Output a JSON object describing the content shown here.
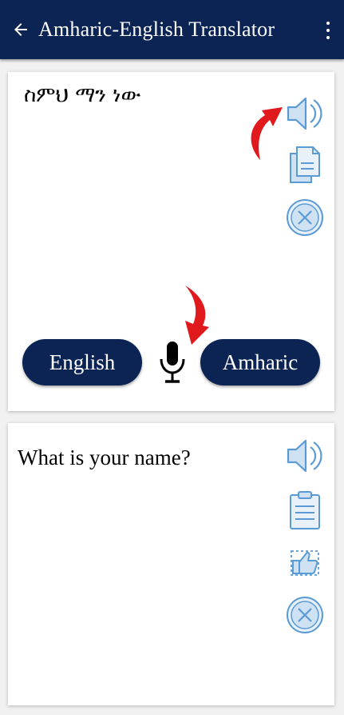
{
  "appbar": {
    "title": "Amharic-English Translator",
    "back_icon": "back-arrow-icon",
    "menu_icon": "more-vert-icon"
  },
  "input_card": {
    "source_text": "ስምህ ማን ነው",
    "actions": [
      "speaker-icon",
      "copy-icon",
      "clear-icon"
    ],
    "source_language": "English",
    "target_language": "Amharic",
    "mic_icon": "microphone-icon"
  },
  "output_card": {
    "translated_text": "What is your name?",
    "actions": [
      "speaker-icon",
      "clipboard-icon",
      "share-icon",
      "clear-icon"
    ]
  },
  "colors": {
    "primary": "#0b2454",
    "icon_blue": "#5b9bd5",
    "icon_fill": "#cfe2f3",
    "annotation_arrow": "#e0191c"
  }
}
